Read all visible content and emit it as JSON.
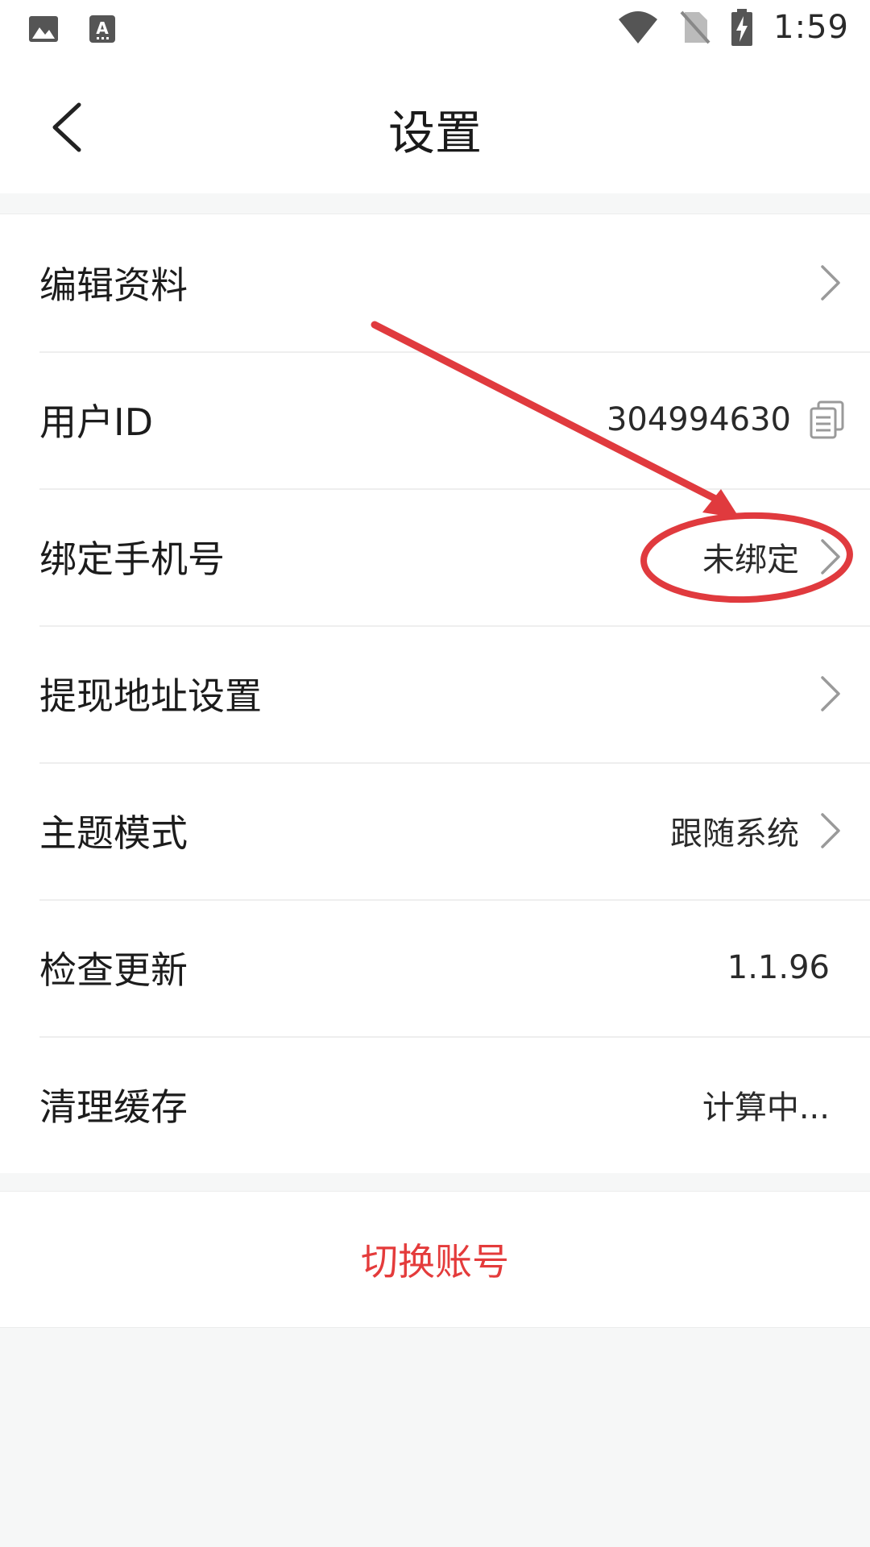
{
  "status_bar": {
    "time": "1:59",
    "left_icons": [
      "image-icon",
      "text-a-icon"
    ],
    "right_icons": [
      "wifi-icon",
      "no-sim-icon",
      "battery-charging-icon"
    ]
  },
  "header": {
    "title": "设置",
    "back_icon": "chevron-left-icon"
  },
  "settings": {
    "items": [
      {
        "label": "编辑资料",
        "value": "",
        "chevron": true,
        "copy": false
      },
      {
        "label": "用户ID",
        "value": "304994630",
        "chevron": false,
        "copy": true
      },
      {
        "label": "绑定手机号",
        "value": "未绑定",
        "chevron": true,
        "copy": false
      },
      {
        "label": "提现地址设置",
        "value": "",
        "chevron": true,
        "copy": false
      },
      {
        "label": "主题模式",
        "value": "跟随系统",
        "chevron": true,
        "copy": false
      },
      {
        "label": "检查更新",
        "value": "1.1.96",
        "chevron": false,
        "copy": false
      },
      {
        "label": "清理缓存",
        "value": "计算中...",
        "chevron": false,
        "copy": false
      }
    ]
  },
  "switch_account": {
    "label": "切换账号"
  },
  "colors": {
    "accent_red": "#e43b3b",
    "annotation_red": "#e03a3e",
    "background": "#f6f7f7",
    "surface": "#ffffff"
  }
}
